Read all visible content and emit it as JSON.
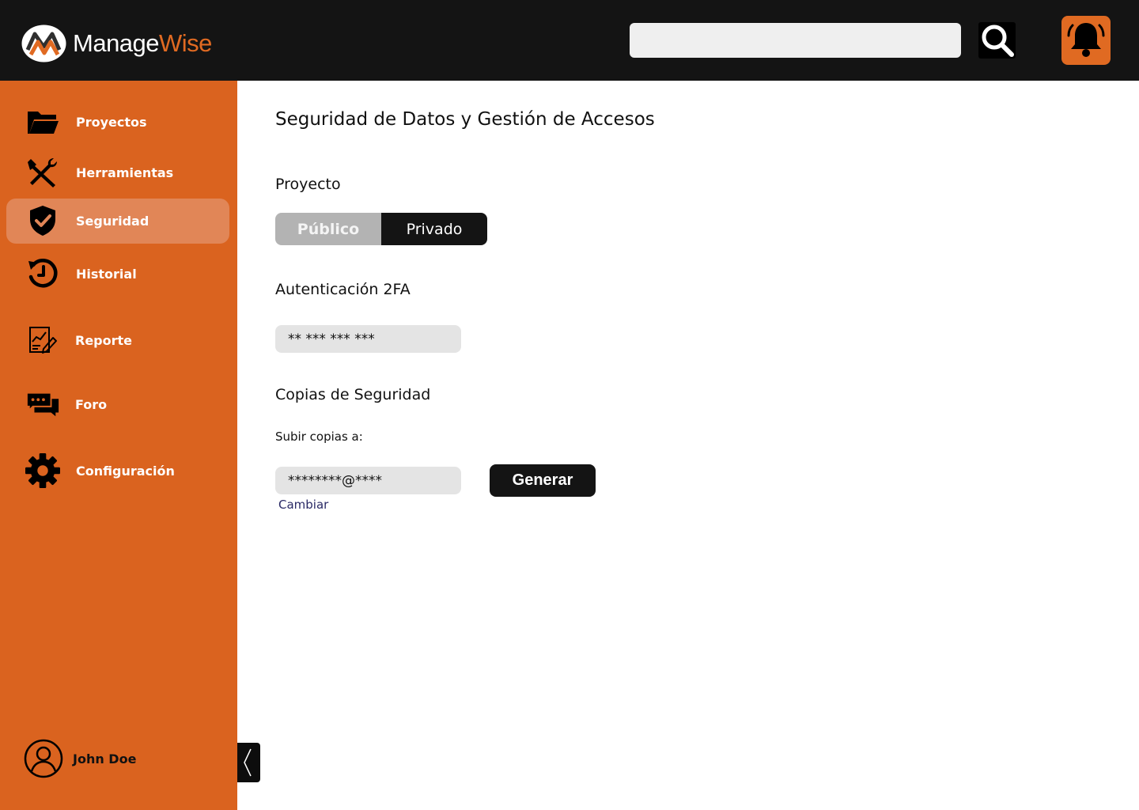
{
  "app": {
    "brand_part1": "Manage",
    "brand_part2": "Wise",
    "colors": {
      "accent": "#da631f",
      "brand_orange": "#e06a22",
      "dark": "#141414",
      "active_nav": "#e18657"
    }
  },
  "header": {
    "search": {
      "value": "",
      "placeholder": ""
    },
    "icons": {
      "search": "search-icon",
      "notifications": "bell-icon"
    }
  },
  "sidebar": {
    "items": [
      {
        "label": "Proyectos",
        "icon": "folder-icon",
        "active": false
      },
      {
        "label": "Herramientas",
        "icon": "tools-icon",
        "active": false
      },
      {
        "label": "Seguridad",
        "icon": "shield-check-icon",
        "active": true
      },
      {
        "label": "Historial",
        "icon": "history-icon",
        "active": false
      },
      {
        "label": "Reporte",
        "icon": "report-icon",
        "active": false
      },
      {
        "label": "Foro",
        "icon": "chat-icon",
        "active": false
      },
      {
        "label": "Configuración",
        "icon": "gear-icon",
        "active": false
      }
    ],
    "user": {
      "name": "John Doe",
      "icon": "user-icon"
    }
  },
  "main": {
    "title": "Seguridad de Datos y Gestión de Accesos",
    "project": {
      "heading": "Proyecto",
      "options": [
        "Público",
        "Privado"
      ],
      "selected": "Privado"
    },
    "two_factor": {
      "heading": "Autenticación 2FA",
      "value": "** *** *** ***"
    },
    "backups": {
      "heading": "Copias de Seguridad",
      "upload_label": "Subir copias a:",
      "email_value": "********@****",
      "generate_label": "Generar",
      "change_label": "Cambiar"
    }
  }
}
